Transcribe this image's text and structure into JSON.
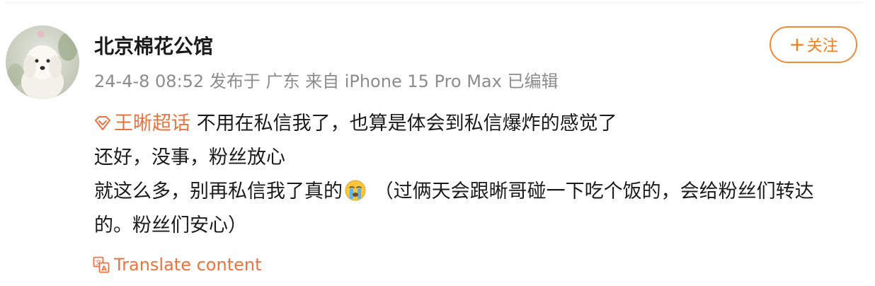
{
  "post": {
    "author": "北京棉花公馆",
    "meta": "24-4-8 08:52 发布于 广东 来自 iPhone 15 Pro Max 已编辑",
    "follow_label": "关注",
    "topic": "王晰超话",
    "line1_text": " 不用在私信我了，也算是体会到私信爆炸的感觉了",
    "line2": "还好，没事，粉丝放心",
    "line3_text": "就这么多，别再私信我了真的",
    "line3_after": " （过俩天会跟晰哥碰一下吃个饭的，会给粉丝们转达的。粉丝们安心）",
    "translate_label": "Translate content"
  },
  "icons": {
    "topic": "diamond-topic-icon",
    "emoji": "crying-face-icon",
    "translate": "translate-icon",
    "follow": "plus-icon"
  },
  "colors": {
    "accent": "#eb7340",
    "follow_border": "#f08b3a",
    "meta_text": "#8c8c8c",
    "body_text": "#1a1a1a"
  }
}
